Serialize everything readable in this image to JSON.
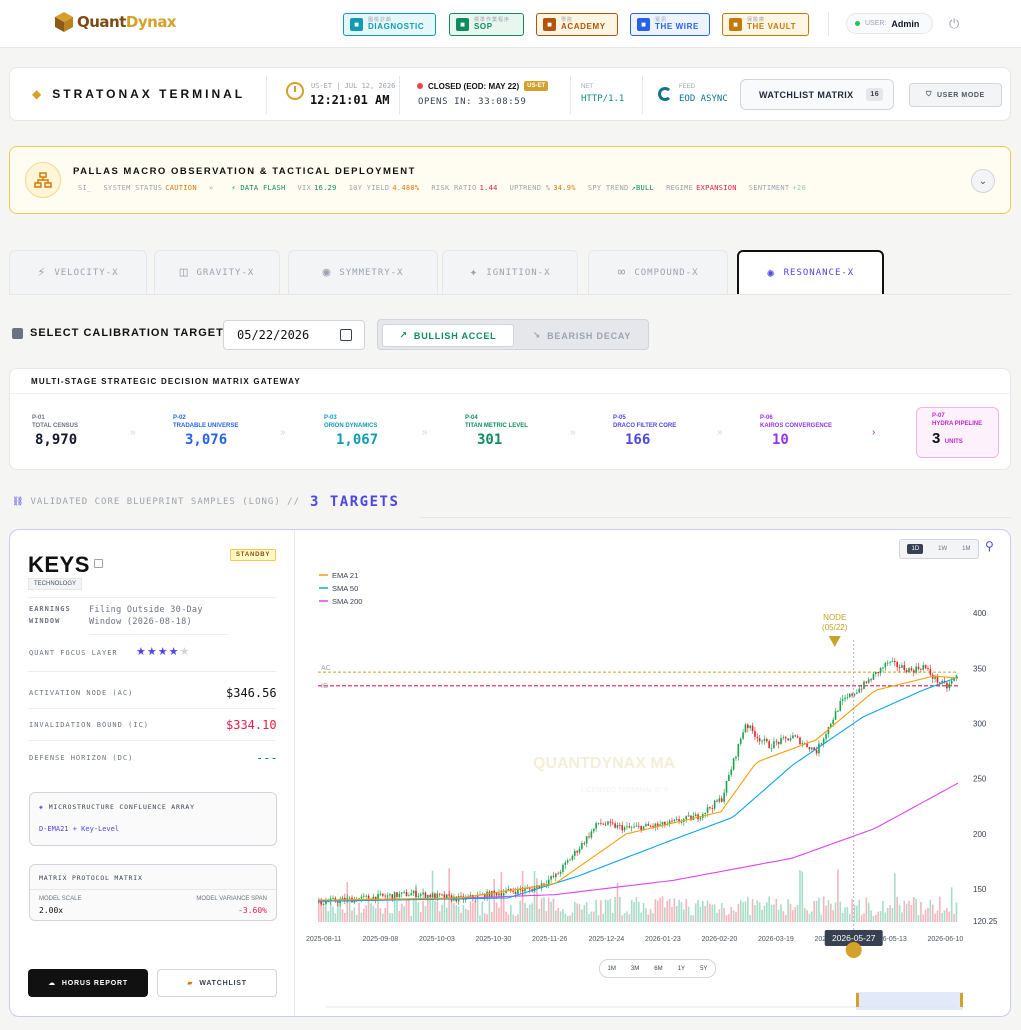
{
  "nav": {
    "buttons": [
      {
        "tiny": "圖檢診斷",
        "label": "DIAGNOSTIC",
        "color": "#0e9cb3",
        "bg": "#e6f7fa"
      },
      {
        "tiny": "標準作業程序",
        "label": "SOP",
        "color": "#0e8c5f",
        "bg": "#e8f6ef"
      },
      {
        "tiny": "學院",
        "label": "ACADEMY",
        "color": "#b45309",
        "bg": "#fdf6e3"
      },
      {
        "tiny": "電訊",
        "label": "THE WIRE",
        "color": "#2563eb",
        "bg": "#eef4ff"
      },
      {
        "tiny": "保險庫",
        "label": "THE VAULT",
        "color": "#c27b0a",
        "bg": "#fdf6e3"
      }
    ],
    "user_label": "USER:",
    "user_name": "Admin"
  },
  "brand": {
    "part1": "Quant",
    "part2": "Dynax"
  },
  "terminal": {
    "title": "STRATONAX TERMINAL",
    "date_line": "US-ET | JUL 12, 2026",
    "time": "12:21:01 AM",
    "market_status": "CLOSED (EOD: MAY 22)",
    "market_badge": "US-ET",
    "opens_in": "OPENS IN: 33:08:59",
    "net_label": "NET",
    "net_value": "HTTP/1.1",
    "feed_label": "FEED",
    "feed_value": "EOD ASYNC",
    "watchlist_label": "WATCHLIST MATRIX",
    "watchlist_count": "16",
    "user_mode": "USER MODE"
  },
  "pallas": {
    "title": "PALLAS MACRO OBSERVATION & TACTICAL DEPLOYMENT",
    "ticker": [
      {
        "k": "",
        "v": "SI_",
        "color": "#9ca3af"
      },
      {
        "k": "SYSTEM STATUS",
        "v": "CAUTION",
        "color": "#d97706"
      },
      {
        "k": "»",
        "v": "",
        "color": "#9ca3af"
      },
      {
        "k": "",
        "v": "⚡ DATA FLASH",
        "color": "#0e8c5f"
      },
      {
        "k": "VIX",
        "v": "16.29",
        "color": "#0e8c5f"
      },
      {
        "k": "10Y YIELD",
        "v": "4.480%",
        "color": "#d97706"
      },
      {
        "k": "RISK RATIO",
        "v": "1.44",
        "color": "#e11d48"
      },
      {
        "k": "UPTREND %",
        "v": "34.9%",
        "color": "#d97706"
      },
      {
        "k": "SPY TREND",
        "v": "↗BULL",
        "color": "#0e8c5f"
      },
      {
        "k": "REGIME",
        "v": "EXPANSION",
        "color": "#e11d48"
      },
      {
        "k": "SENTIMENT",
        "v": "+20",
        "color": "#86d1b0"
      }
    ]
  },
  "tabs": [
    "VELOCITY-X",
    "GRAVITY-X",
    "SYMMETRY-X",
    "IGNITION-X",
    "COMPOUND-X",
    "RESONANCE-X"
  ],
  "calibration": {
    "label": "SELECT CALIBRATION TARGET",
    "date": "05/22/2026",
    "bullish": "BULLISH ACCEL",
    "bearish": "BEARISH DECAY"
  },
  "matrix": {
    "title": "MULTI-STAGE STRATEGIC DECISION MATRIX GATEWAY",
    "stages": [
      {
        "p": "P-01",
        "name": "TOTAL CENSUS",
        "value": "8,970",
        "color": "#6b7280",
        "vcolor": "#111827"
      },
      {
        "p": "P-02",
        "name": "TRADABLE UNIVERSE",
        "value": "3,076",
        "color": "#2563eb",
        "vcolor": "#2563eb"
      },
      {
        "p": "P-03",
        "name": "ORION DYNAMICS",
        "value": "1,067",
        "color": "#0e9cb3",
        "vcolor": "#0e9cb3"
      },
      {
        "p": "P-04",
        "name": "TITAN METRIC LEVEL",
        "value": "301",
        "color": "#0e8c5f",
        "vcolor": "#0e8c5f"
      },
      {
        "p": "P-05",
        "name": "DRACO FILTER CORE",
        "value": "166",
        "color": "#4f46e5",
        "vcolor": "#4f46e5"
      },
      {
        "p": "P-06",
        "name": "KAIROS CONVERGENCE",
        "value": "10",
        "color": "#9333ea",
        "vcolor": "#9333ea"
      }
    ],
    "final": {
      "p": "P-07",
      "name": "HYDRA PIPELINE",
      "value": "3",
      "unit": "UNITS"
    }
  },
  "validated": {
    "label": "VALIDATED CORE BLUEPRINT SAMPLES (LONG) //",
    "count": "3 TARGETS"
  },
  "stock": {
    "ticker": "KEYS",
    "sector": "TECHNOLOGY",
    "status": "STANDBY",
    "earnings_key1": "EARNINGS",
    "earnings_key2": "WINDOW",
    "earnings_value1": "Filing Outside 30-Day",
    "earnings_value2": "Window (2026-08-18)",
    "focus_label": "QUANT FOCUS LAYER",
    "focus_stars": 4,
    "ac_label": "ACTIVATION NODE (AC)",
    "ac_value": "$346.56",
    "ic_label": "INVALIDATION BOUND (IC)",
    "ic_value": "$334.10",
    "dc_label": "DEFENSE HORIZON (DC)",
    "dc_value": "---",
    "confluence_title": "MICROSTRUCTURE CONFLUENCE ARRAY",
    "confluence_value": "D-EMA21 + Key-Level",
    "protocol_title": "MATRIX PROTOCOL MATRIX",
    "model_scale_label": "MODEL SCALE",
    "model_scale_value": "2.00x",
    "variance_label": "MODEL VARIANCE SPAN",
    "variance_value": "-3.60%",
    "horus_btn": "HORUS REPORT",
    "watch_btn": "WATCHLIST"
  },
  "chart_data": {
    "type": "candlestick",
    "timeframes": [
      "1D",
      "1W",
      "1M"
    ],
    "selected_timeframe": "1D",
    "ranges": [
      "1M",
      "3M",
      "6M",
      "1Y",
      "5Y"
    ],
    "legend": [
      {
        "name": "EMA 21",
        "color": "#f59e0b"
      },
      {
        "name": "SMA 50",
        "color": "#0ea5e9"
      },
      {
        "name": "SMA 200",
        "color": "#d946ef"
      }
    ],
    "y_ticks": [
      400,
      350,
      300,
      250,
      200,
      150,
      120.25
    ],
    "ylim": [
      120.25,
      410
    ],
    "x_ticks": [
      "2025-08-11",
      "2025-09-08",
      "2025-10-03",
      "2025-10-30",
      "2025-11-26",
      "2025-12-24",
      "2026-01-23",
      "2026-02-20",
      "2026-03-19",
      "2026-04-16",
      "2026-05-13",
      "2026-06-10"
    ],
    "ac_level": 346.56,
    "ic_level": 334.1,
    "ac_tag": "AC",
    "ic_tag": "IC",
    "node_label": "NODE",
    "node_date": "(05/22)",
    "cursor_date": "2026-05-27",
    "watermark": "QUANTDYNAX MA",
    "watermark_sub": "LICENSED TERMINAL ID #",
    "close_anchors": [
      [
        0,
        138
      ],
      [
        20,
        142
      ],
      [
        40,
        146
      ],
      [
        60,
        141
      ],
      [
        80,
        148
      ],
      [
        90,
        150
      ],
      [
        100,
        162
      ],
      [
        110,
        188
      ],
      [
        118,
        210
      ],
      [
        130,
        205
      ],
      [
        145,
        208
      ],
      [
        160,
        216
      ],
      [
        170,
        232
      ],
      [
        180,
        300
      ],
      [
        185,
        288
      ],
      [
        190,
        280
      ],
      [
        200,
        288
      ],
      [
        210,
        275
      ],
      [
        220,
        318
      ],
      [
        230,
        335
      ],
      [
        240,
        355
      ],
      [
        250,
        348
      ],
      [
        255,
        352
      ],
      [
        260,
        340
      ],
      [
        265,
        333
      ],
      [
        270,
        345
      ]
    ],
    "ema21_anchors": [
      [
        0,
        140
      ],
      [
        60,
        142
      ],
      [
        100,
        155
      ],
      [
        130,
        200
      ],
      [
        170,
        220
      ],
      [
        185,
        265
      ],
      [
        210,
        285
      ],
      [
        235,
        330
      ],
      [
        260,
        343
      ],
      [
        270,
        341
      ]
    ],
    "sma50_anchors": [
      [
        0,
        139
      ],
      [
        80,
        142
      ],
      [
        110,
        162
      ],
      [
        150,
        195
      ],
      [
        175,
        215
      ],
      [
        200,
        262
      ],
      [
        230,
        306
      ],
      [
        255,
        330
      ],
      [
        270,
        342
      ]
    ],
    "sma200_anchors": [
      [
        0,
        139
      ],
      [
        50,
        141
      ],
      [
        100,
        145
      ],
      [
        150,
        158
      ],
      [
        200,
        178
      ],
      [
        235,
        205
      ],
      [
        270,
        246
      ]
    ]
  }
}
